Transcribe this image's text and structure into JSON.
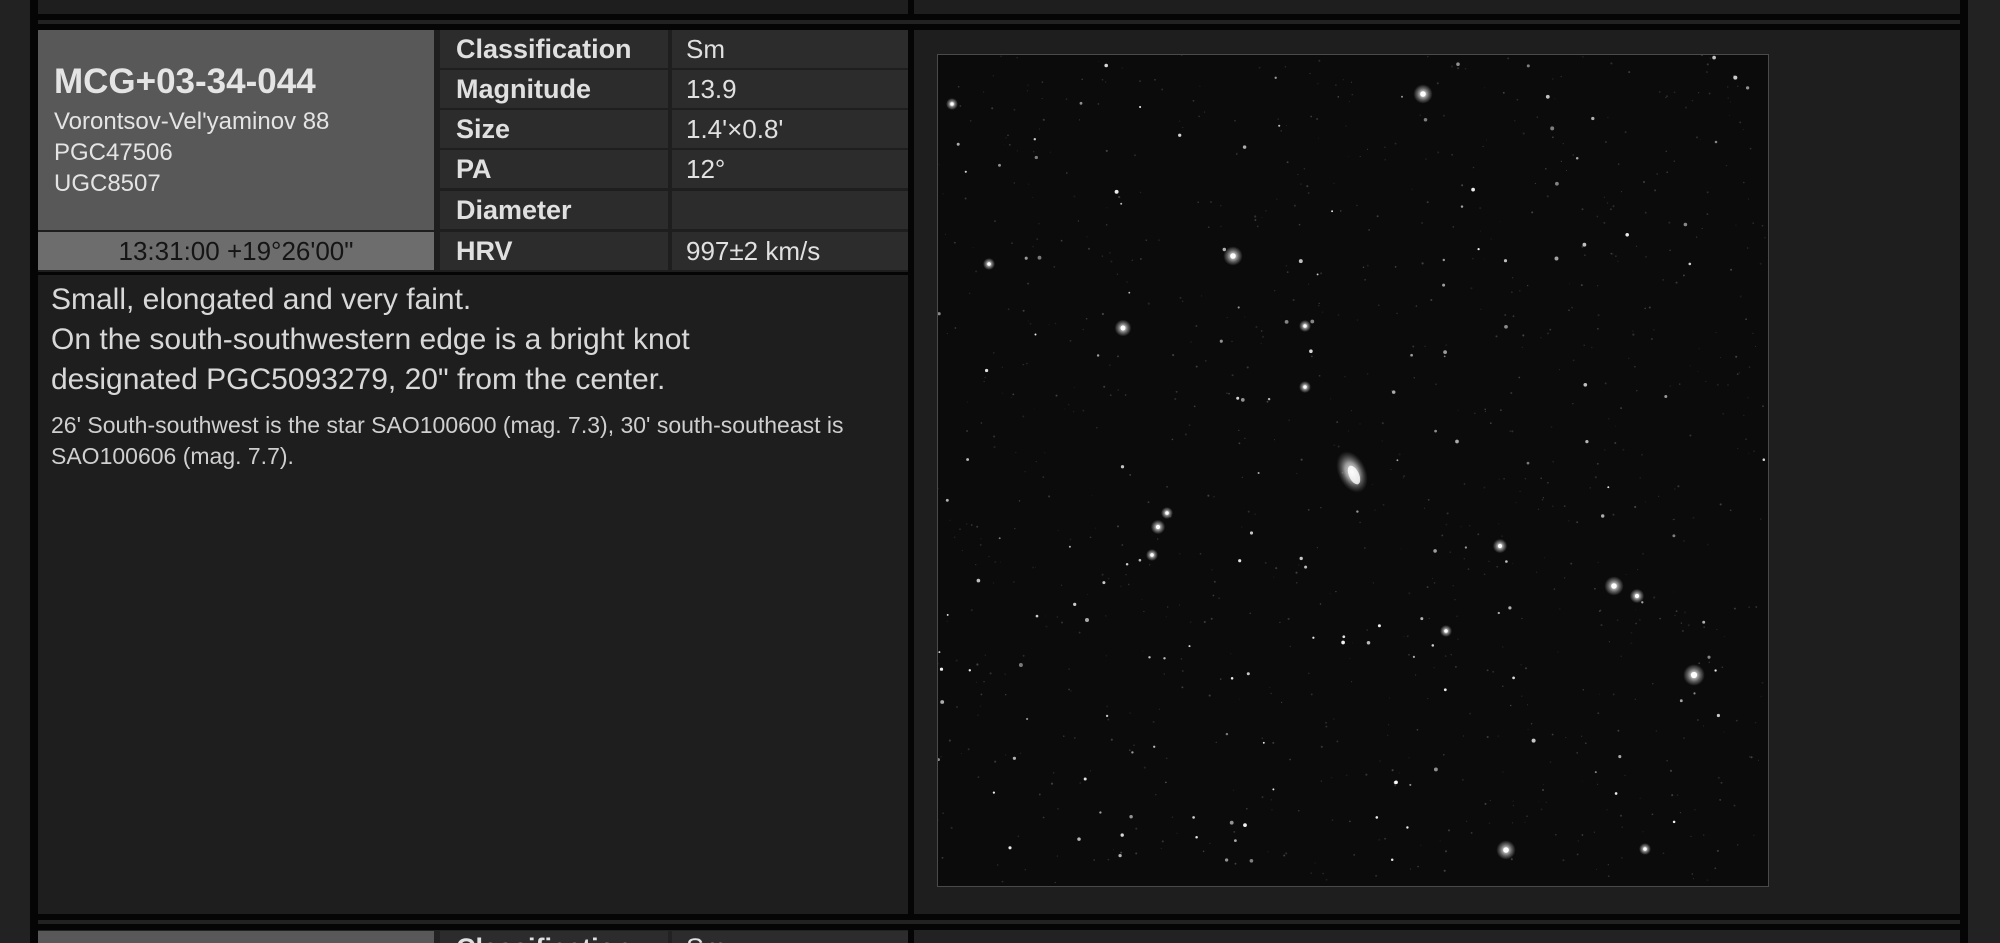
{
  "object": {
    "name": "MCG+03-34-044",
    "aliases": [
      "Vorontsov-Vel'yaminov 88",
      "PGC47506",
      "UGC8507"
    ],
    "coordinates": "13:31:00 +19°26'00\""
  },
  "properties": [
    {
      "key": "Classification",
      "value": "Sm"
    },
    {
      "key": "Magnitude",
      "value": "13.9"
    },
    {
      "key": "Size",
      "value": "1.4'×0.8'"
    },
    {
      "key": "PA",
      "value": "12°"
    },
    {
      "key": "Diameter",
      "value": ""
    },
    {
      "key": "HRV",
      "value": "997±2 km/s"
    }
  ],
  "description": {
    "main_lines": [
      "Small, elongated and very faint.",
      "On the south-southwestern edge is a bright knot",
      "designated PGC5093279, 20\" from the center."
    ],
    "note": "26' South-southwest is the star SAO100600 (mag. 7.3), 30' south-southeast is SAO100606 (mag. 7.7)."
  },
  "next_entry": {
    "key": "Classification",
    "value": "Sm"
  }
}
